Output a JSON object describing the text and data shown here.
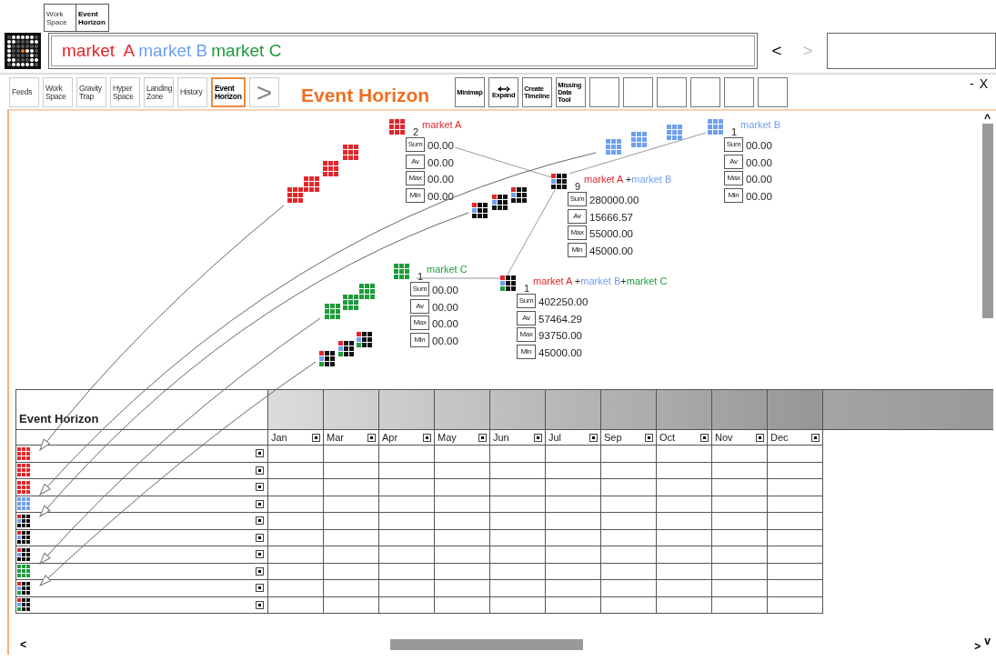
{
  "top_tabs": [
    {
      "label": "Work Space",
      "selected": false
    },
    {
      "label": "Event Horizon",
      "selected": true
    }
  ],
  "search": {
    "terms": [
      {
        "text": "market  A",
        "color": "#e3262a"
      },
      {
        "text": "market B",
        "color": "#6f9ff0"
      },
      {
        "text": "market C",
        "color": "#1e9c3c"
      }
    ]
  },
  "nav": [
    {
      "label": "<",
      "disabled": false
    },
    {
      "label": ">",
      "disabled": true
    }
  ],
  "tabs": [
    {
      "label": "Feeds",
      "selected": false
    },
    {
      "label": "Work Space",
      "selected": false
    },
    {
      "label": "Gravity Trap",
      "selected": false
    },
    {
      "label": "Hyper Space",
      "selected": false
    },
    {
      "label": "Landing Zone",
      "selected": false
    },
    {
      "label": "History",
      "selected": false
    },
    {
      "label": "Event Horizon",
      "selected": true
    }
  ],
  "more_tabs": ">",
  "title": "Event Horizon",
  "tools": [
    {
      "kind": "text",
      "label": "Minimap"
    },
    {
      "kind": "expand",
      "label": "Expand"
    },
    {
      "kind": "text",
      "label": "Create Timeline"
    },
    {
      "kind": "text",
      "label": "Missing Data Tool"
    },
    {
      "kind": "blank"
    },
    {
      "kind": "blank"
    },
    {
      "kind": "blank"
    },
    {
      "kind": "blank"
    },
    {
      "kind": "blank"
    },
    {
      "kind": "blank"
    }
  ],
  "window_controls": [
    "-",
    "X"
  ],
  "trails": [
    {
      "kind": "a"
    },
    {
      "kind": "b"
    },
    {
      "kind": "ab"
    },
    {
      "kind": "c"
    },
    {
      "kind": "abc"
    }
  ],
  "nodes": [
    {
      "kind": "a",
      "count": "2",
      "label": [
        {
          "text": "market A",
          "color": "#e3262a"
        }
      ],
      "stats": [
        {
          "label": "Sum",
          "value": "00.00"
        },
        {
          "label": "Av",
          "value": "00.00"
        },
        {
          "label": "Max",
          "value": "00.00"
        },
        {
          "label": "Min",
          "value": "00.00"
        }
      ]
    },
    {
      "kind": "b",
      "count": "1",
      "label": [
        {
          "text": "market B",
          "color": "#6f9ff0"
        }
      ],
      "stats": [
        {
          "label": "Sum",
          "value": "00.00"
        },
        {
          "label": "Av",
          "value": "00.00"
        },
        {
          "label": "Max",
          "value": "00.00"
        },
        {
          "label": "Min",
          "value": "00.00"
        }
      ]
    },
    {
      "kind": "ab",
      "count": "9",
      "label": [
        {
          "text": "market A ",
          "color": "#e3262a"
        },
        {
          "text": "+",
          "color": "#333333"
        },
        {
          "text": "market B",
          "color": "#6f9ff0"
        }
      ],
      "stats": [
        {
          "label": "Sum",
          "value": "280000.00"
        },
        {
          "label": "Av",
          "value": "15666.57"
        },
        {
          "label": "Max",
          "value": "55000.00"
        },
        {
          "label": "Min",
          "value": "45000.00"
        }
      ]
    },
    {
      "kind": "c",
      "count": "1",
      "label": [
        {
          "text": "market C",
          "color": "#1e9c3c"
        }
      ],
      "stats": [
        {
          "label": "Sum",
          "value": "00.00"
        },
        {
          "label": "Av",
          "value": "00.00"
        },
        {
          "label": "Max",
          "value": "00.00"
        },
        {
          "label": "Min",
          "value": "00.00"
        }
      ]
    },
    {
      "kind": "abc",
      "count": "1",
      "label": [
        {
          "text": "market A ",
          "color": "#e3262a"
        },
        {
          "text": "+",
          "color": "#333333"
        },
        {
          "text": "market B",
          "color": "#6f9ff0"
        },
        {
          "text": "+",
          "color": "#333333"
        },
        {
          "text": "market C",
          "color": "#1e9c3c"
        }
      ],
      "stats": [
        {
          "label": "Sum",
          "value": "402250.00"
        },
        {
          "label": "Av",
          "value": "57464.29"
        },
        {
          "label": "Max",
          "value": "93750.00"
        },
        {
          "label": "Min",
          "value": "45000.00"
        }
      ]
    }
  ],
  "table": {
    "title": "Event Horizon",
    "months": [
      "Jan",
      "Mar",
      "Apr",
      "May",
      "Jun",
      "Jul",
      "Sep",
      "Oct",
      "Nov",
      "Dec"
    ],
    "rows": [
      {
        "kind": "a"
      },
      {
        "kind": "a"
      },
      {
        "kind": "a"
      },
      {
        "kind": "b"
      },
      {
        "kind": "ab"
      },
      {
        "kind": "ab"
      },
      {
        "kind": "ab"
      },
      {
        "kind": "c"
      },
      {
        "kind": "abc"
      },
      {
        "kind": "abc"
      }
    ]
  },
  "scroll": {
    "up": "^",
    "left": "<",
    "right": ">",
    "down": "v"
  }
}
